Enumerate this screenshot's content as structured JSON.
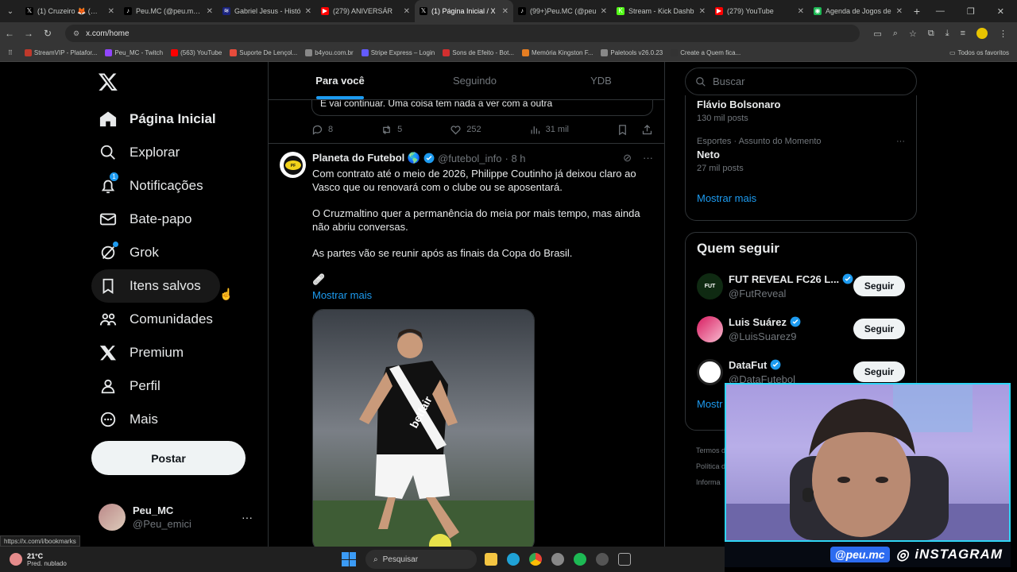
{
  "browser": {
    "tabs": [
      {
        "title": "(1) Cruzeiro 🦊 (@Cr",
        "fav": "𝕏",
        "color": "#000000",
        "active": false
      },
      {
        "title": "Peu.MC (@peu.mc) |",
        "fav": "♪",
        "color": "#000000",
        "active": false
      },
      {
        "title": "Gabriel Jesus - Histó",
        "fav": "≋",
        "color": "#1a237e",
        "active": false
      },
      {
        "title": "(279) ANIVERSÁR",
        "fav": "▶",
        "color": "#ff0000",
        "active": false
      },
      {
        "title": "(1) Página Inicial / X",
        "fav": "𝕏",
        "color": "#000000",
        "active": true
      },
      {
        "title": "(99+)Peu.MC (@peu",
        "fav": "♪",
        "color": "#000000",
        "active": false
      },
      {
        "title": "Stream - Kick Dashb",
        "fav": "K",
        "color": "#53fc18",
        "active": false
      },
      {
        "title": "(279) YouTube",
        "fav": "▶",
        "color": "#ff0000",
        "active": false
      },
      {
        "title": "Agenda de Jogos de",
        "fav": "◉",
        "color": "#1db954",
        "active": false
      }
    ],
    "url": "x.com/home",
    "bookmarks": [
      {
        "label": "StreamVIP - Platafor...",
        "color": "#c0392b"
      },
      {
        "label": "Peu_MC - Twitch",
        "color": "#9146ff"
      },
      {
        "label": "(563) YouTube",
        "color": "#ff0000"
      },
      {
        "label": "Suporte De Lençol...",
        "color": "#e74c3c"
      },
      {
        "label": "b4you.com.br",
        "color": "#888888"
      },
      {
        "label": "Stripe Express – Login",
        "color": "#635bff"
      },
      {
        "label": "Sons de Efeito - Bot...",
        "color": "#d32f2f"
      },
      {
        "label": "Memória Kingston F...",
        "color": "#e67e22"
      },
      {
        "label": "Paletools v26.0.23",
        "color": "#888888"
      },
      {
        "label": "Create a Quem fica...",
        "color": "#333333"
      }
    ],
    "all_bookmarks": "Todos os favoritos",
    "status_url": "https://x.com/i/bookmarks"
  },
  "sidebar": {
    "items": [
      {
        "label": "Página Inicial",
        "icon": "home-icon"
      },
      {
        "label": "Explorar",
        "icon": "search-icon"
      },
      {
        "label": "Notificações",
        "icon": "bell-icon",
        "badge": "1"
      },
      {
        "label": "Bate-papo",
        "icon": "mail-icon"
      },
      {
        "label": "Grok",
        "icon": "grok-icon"
      },
      {
        "label": "Itens salvos",
        "icon": "bookmark-icon"
      },
      {
        "label": "Comunidades",
        "icon": "people-icon"
      },
      {
        "label": "Premium",
        "icon": "x-icon"
      },
      {
        "label": "Perfil",
        "icon": "person-icon"
      },
      {
        "label": "Mais",
        "icon": "more-circle-icon"
      }
    ],
    "post_label": "Postar",
    "account": {
      "name": "Peu_MC",
      "handle": "@Peu_emici",
      "more": "···"
    }
  },
  "timeline": {
    "tabs": [
      "Para você",
      "Seguindo",
      "YDB"
    ],
    "prev_quote_text": "E vai continuar. Uma coisa tem nada a ver com  a outra",
    "prev_actions": {
      "replies": "8",
      "reposts": "5",
      "likes": "252",
      "views": "31 mil"
    },
    "tweet": {
      "name": "Planeta do Futebol 🌎",
      "handle": "@futebol_info",
      "time": "· 8 h",
      "paragraphs": [
        "Com contrato até o meio de 2026, Philippe Coutinho já deixou claro ao Vasco que ou renovará com o clube ou se aposentará.",
        "O Cruzmaltino quer a permanência do meia por mais tempo, mas ainda não abriu conversas.",
        "As partes vão se reunir após as finais da Copa do Brasil.",
        "🩹"
      ],
      "show_more": "Mostrar mais",
      "jersey_text": "betfair"
    }
  },
  "right": {
    "search_placeholder": "Buscar",
    "trends": [
      {
        "meta": "",
        "name": "Flávio Bolsonaro",
        "count": "130 mil posts"
      },
      {
        "meta": "Esportes · Assunto do Momento",
        "name": "Neto",
        "count": "27 mil posts"
      }
    ],
    "trends_more": "Mostrar mais",
    "follow_title": "Quem seguir",
    "follow": [
      {
        "name": "FUT REVEAL FC26 L...",
        "handle": "@FutReveal",
        "button": "Seguir",
        "color": "#1b5e20"
      },
      {
        "name": "Luis Suárez",
        "handle": "@LuisSuarez9",
        "button": "Seguir",
        "color": "#c2185b"
      },
      {
        "name": "DataFut",
        "handle": "@DataFutebol",
        "button": "Seguir",
        "color": "#ffffff"
      }
    ],
    "follow_more": "Mostr",
    "footer": [
      "Termos d",
      "Política d",
      "Informa"
    ]
  },
  "stream_overlay": {
    "handle": "@peu.mc",
    "network": "iNSTAGRAM"
  },
  "taskbar": {
    "temp": "21°C",
    "desc": "Pred. nublado",
    "search": "Pesquisar"
  },
  "colors": {
    "accent": "#1d9bf0",
    "cam_border": "#2fd5f5"
  }
}
